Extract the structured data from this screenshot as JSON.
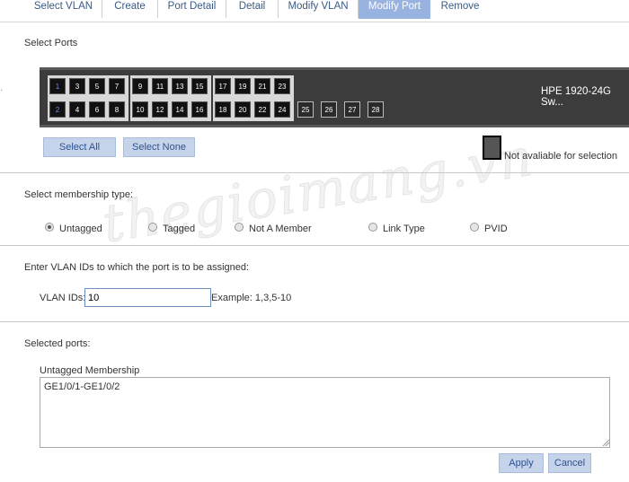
{
  "tabs": [
    {
      "label": "Select VLAN"
    },
    {
      "label": "Create"
    },
    {
      "label": "Port Detail"
    },
    {
      "label": "Detail"
    },
    {
      "label": "Modify VLAN"
    },
    {
      "label": "Modify Port"
    },
    {
      "label": "Remove"
    }
  ],
  "active_tab": "Modify Port",
  "select_ports_label": "Select Ports",
  "switch": {
    "model": "HPE 1920-24G Sw...",
    "ports_top": [
      "1",
      "3",
      "5",
      "7",
      "9",
      "11",
      "13",
      "15",
      "17",
      "19",
      "21",
      "23"
    ],
    "ports_bottom": [
      "2",
      "4",
      "6",
      "8",
      "10",
      "12",
      "14",
      "16",
      "18",
      "20",
      "22",
      "24"
    ],
    "ports_extra": [
      "25",
      "26",
      "27",
      "28"
    ],
    "selected_ports": [
      "1",
      "2"
    ],
    "selected_color": "#6e8cff"
  },
  "buttons": {
    "select_all": "Select All",
    "select_none": "Select None",
    "apply": "Apply",
    "cancel": "Cancel"
  },
  "legend": {
    "text": "Not avaliable for selection"
  },
  "membership": {
    "label": "Select membership type:",
    "options": [
      "Untagged",
      "Tagged",
      "Not A Member",
      "Link Type",
      "PVID"
    ],
    "selected": "Untagged"
  },
  "vlan_section": {
    "label": "Enter VLAN IDs to which the port is to be assigned:",
    "field_label": "VLAN IDs:",
    "value": "10",
    "example": "Example: 1,3,5-10"
  },
  "selected_ports": {
    "label": "Selected ports:",
    "membership_label": "Untagged Membership",
    "value": "GE1/0/1-GE1/0/2"
  },
  "watermark": "thegioimang.vn",
  "colors": {
    "accent": "#99b3e0",
    "button_bg": "#c5d4ea",
    "link": "#3a5a85"
  }
}
